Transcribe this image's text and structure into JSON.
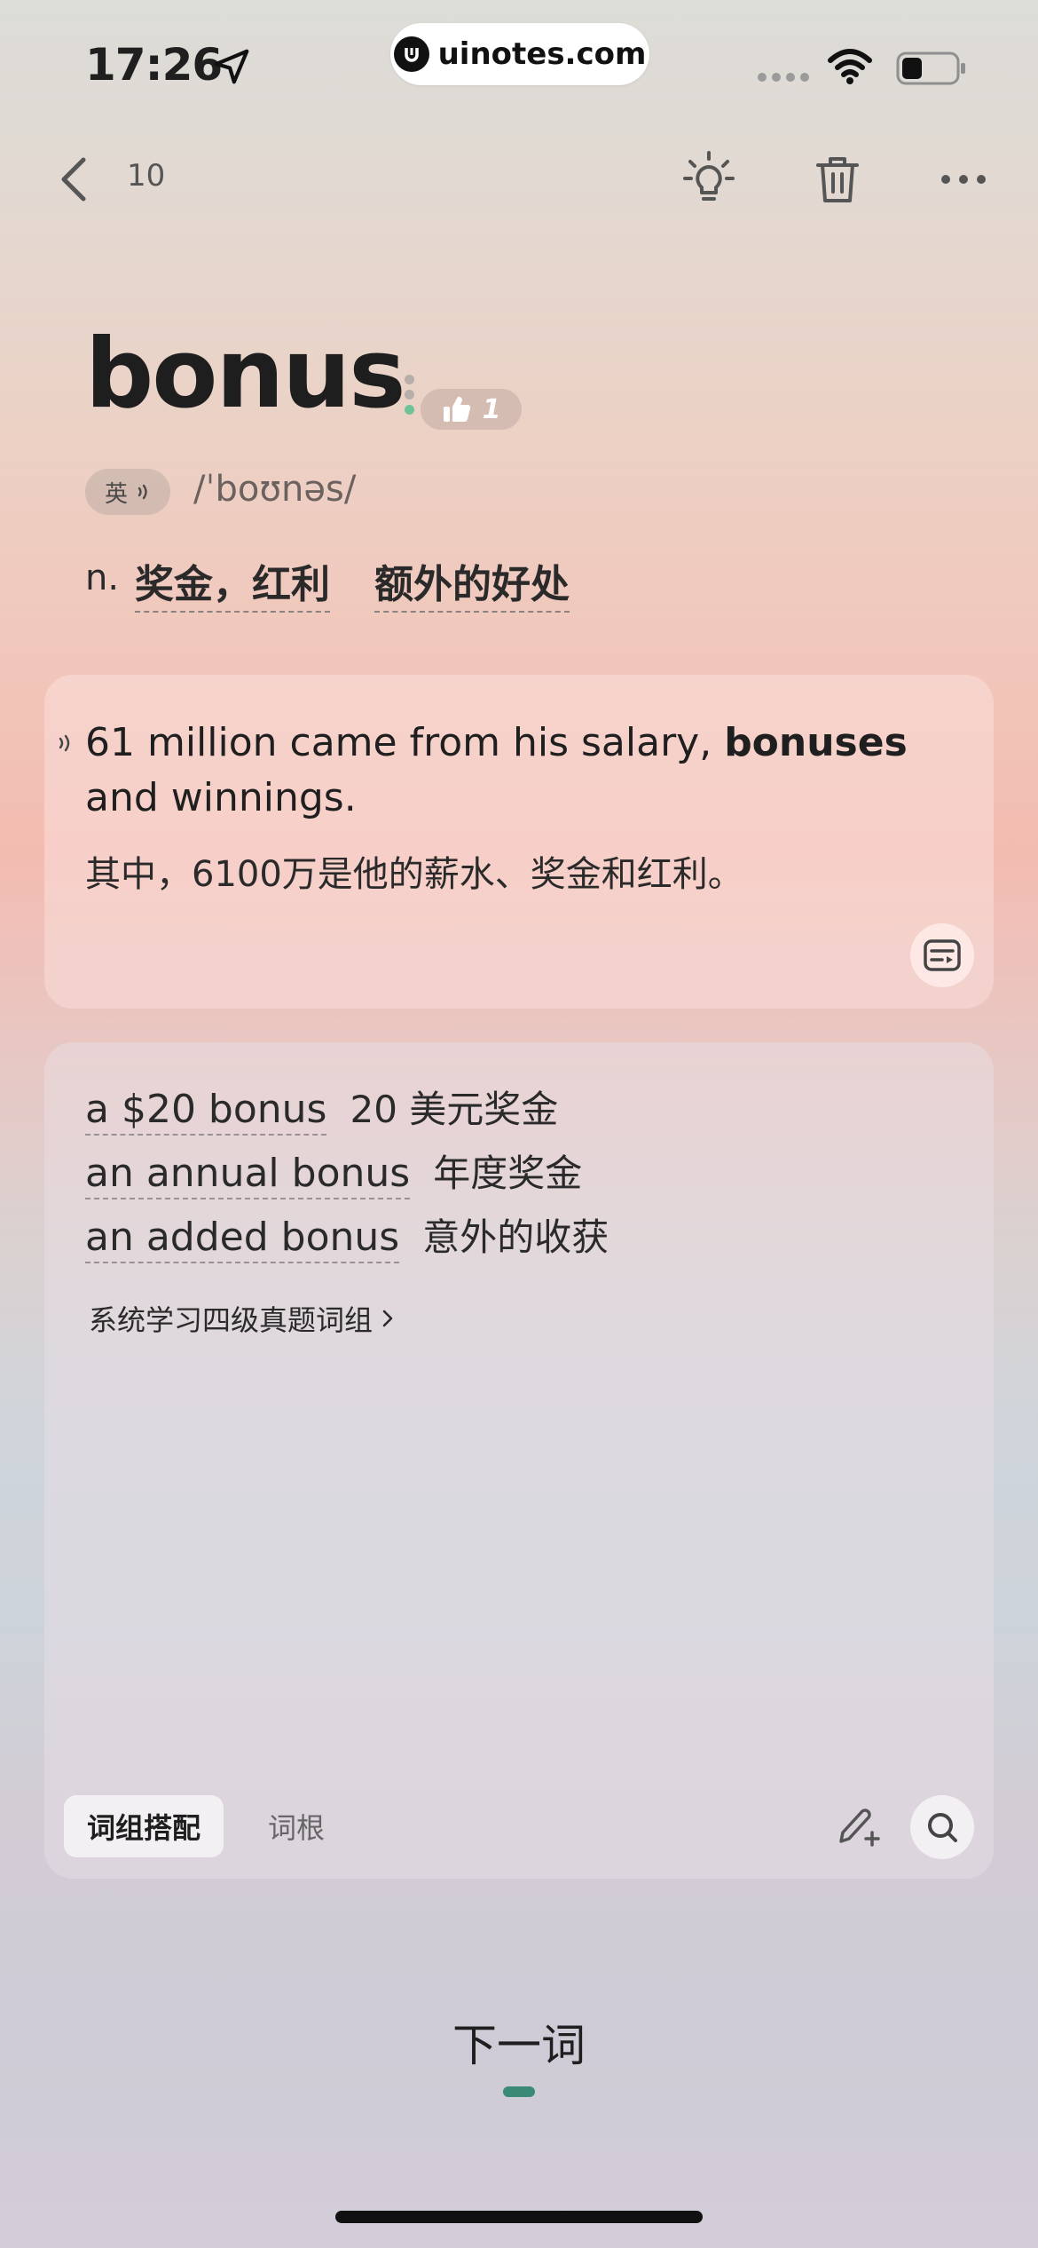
{
  "status_bar": {
    "time": "17:26",
    "url": "uinotes.com"
  },
  "toolbar": {
    "count": "10"
  },
  "word": {
    "text": "bonus",
    "like_count": "1",
    "accent": "英",
    "phonetic": "/ˈboʊnəs/",
    "pos": "n.",
    "definitions": [
      "奖金，红利",
      "额外的好处"
    ]
  },
  "example": {
    "en_before": "61 million came from his salary, ",
    "en_bold": "bonuses",
    "en_after": " and winnings.",
    "zh": "其中，6100万是他的薪水、奖金和红利。"
  },
  "phrases": [
    {
      "en": "a $20 bonus",
      "zh": "20 美元奖金"
    },
    {
      "en": "an annual bonus",
      "zh": "年度奖金"
    },
    {
      "en": "an added bonus",
      "zh": "意外的收获"
    }
  ],
  "book_link": "系统学习四级真题词组",
  "tabs": {
    "active": "词组搭配",
    "inactive": "词根"
  },
  "next_word": "下一词",
  "colors": {
    "accent_green": "#3a8a76",
    "text": "#1f1f1f"
  }
}
